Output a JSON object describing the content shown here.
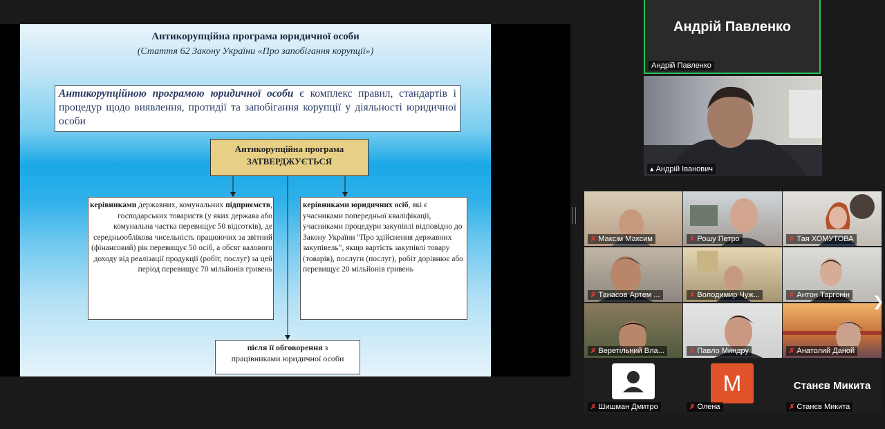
{
  "slide": {
    "title": "Антикорупційна програма юридичної особи",
    "subtitle": "(Стаття 62 Закону України «Про запобігання корупції»)",
    "definition_bold": "Антикорупційною програмою юридичної особи",
    "definition_rest": " є комплекс правил, стандартів і процедур щодо виявлення, протидії та запобігання корупції у діяльності юридичної особи",
    "approve_line1": "Антикорупційна програма",
    "approve_line2": "ЗАТВЕРДЖУЄТЬСЯ",
    "left_b1": "керівниками",
    "left_t1": " державних, комунальних ",
    "left_b2": "підприємств",
    "left_t2": ", господарських товариств (у яких держава або комунальна частка перевищує 50 відсотків), де середньооблікова чисельність працюючих за звітний (фінансовий) рік перевищує 50 осіб, а обсяг валового доходу від реалізації продукції (робіт, послуг) за цей період перевищує 70 мільйонів гривень",
    "right_b": "керівниками юридичних осіб",
    "right_t": ", які є учасниками попередньої кваліфікації, учасниками процедури закупівлі відповідно до Закону України \"Про здійснення державних закупівель\", якщо вартість закупівлі товару (товарів), послуги (послуг), робіт дорівнює або перевищує 20 мільйонів гривень",
    "bottom_b": "після її обговорення",
    "bottom_t1": " з",
    "bottom_t2": "працівниками юридичної особи"
  },
  "speaker": {
    "name_big": "Андрій Павленко",
    "label": "Андрій Павленко"
  },
  "pinned": {
    "label": "Андрій Іванович"
  },
  "participants": [
    {
      "name": "Максім Максим"
    },
    {
      "name": "Рошу Петро"
    },
    {
      "name": "Тая ХОМУТОВА"
    },
    {
      "name": "Танасов Артем ..."
    },
    {
      "name": "Володимир Чуж..."
    },
    {
      "name": "Антон Таргонін"
    },
    {
      "name": "Веретільний Вла..."
    },
    {
      "name": "Павло Миндру"
    },
    {
      "name": "Анатолий Даной"
    },
    {
      "name": "Шишман Дмитро"
    },
    {
      "name": "Олена",
      "avatar_letter": "M"
    },
    {
      "name": "Станєв Микита",
      "name_big": "Станєв Микита"
    }
  ],
  "colors": {
    "active_speaker_border": "#22c55e",
    "muted_mic": "#e23a3a",
    "avatar_orange": "#e0522a"
  }
}
